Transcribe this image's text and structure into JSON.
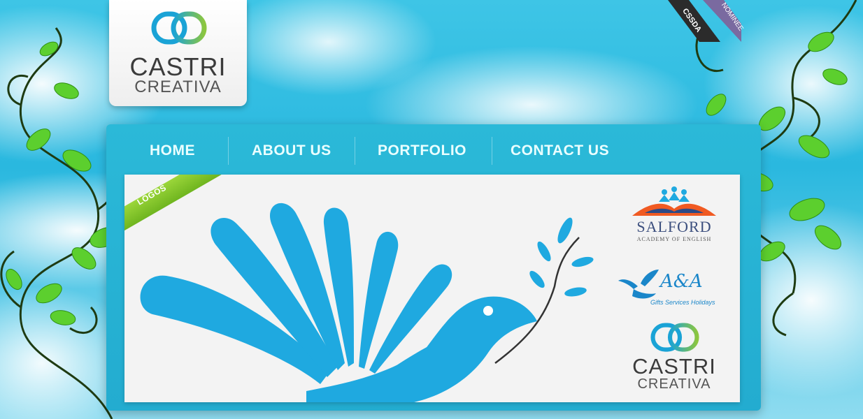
{
  "brand": {
    "line1": "CASTRI",
    "line2": "CREATIVA"
  },
  "award": {
    "org": "CSSDA",
    "label": "NOMINEE"
  },
  "nav": {
    "items": [
      {
        "label": "HOME"
      },
      {
        "label": "ABOUT US"
      },
      {
        "label": "PORTFOLIO"
      },
      {
        "label": "CONTACT US"
      }
    ]
  },
  "showcase": {
    "tag": "LOGOS",
    "thumbnails": [
      {
        "name": "SALFORD",
        "subtitle": "ACADEMY OF ENGLISH"
      },
      {
        "name": "A&A",
        "subtitle": "Gifts Services Holidays"
      },
      {
        "name_line1": "CASTRI",
        "name_line2": "CREATIVA"
      }
    ]
  },
  "colors": {
    "sky": "#2ab8df",
    "frame": "#2bb9d8",
    "nav_text": "#eaffff",
    "bird_blue": "#1fa9e0",
    "tag_green": "#7cc126",
    "panel": "#f3f3f3"
  }
}
